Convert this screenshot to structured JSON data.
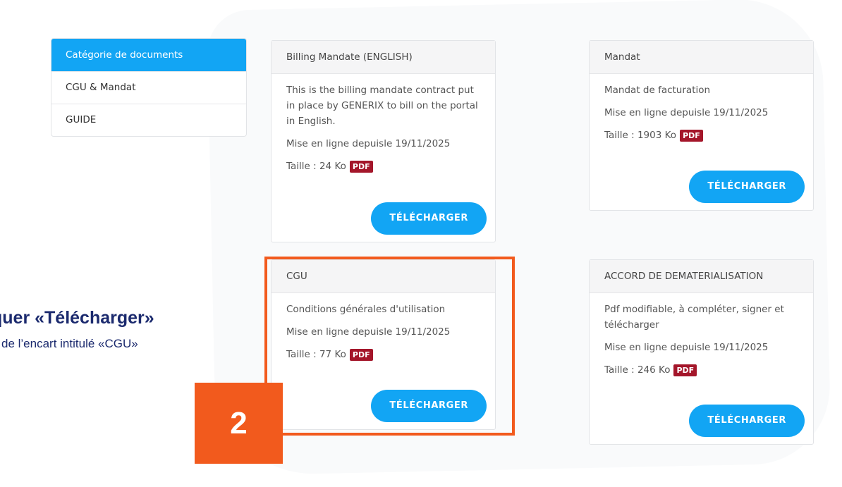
{
  "sidebar": {
    "items": [
      {
        "label": "Catégorie de documents",
        "active": true
      },
      {
        "label": "CGU & Mandat"
      },
      {
        "label": "GUIDE"
      }
    ]
  },
  "cards": [
    {
      "title": "Billing Mandate (ENGLISH)",
      "description": "This is the billing mandate contract put in place by GENERIX to bill on the portal in English.",
      "date": "Mise en ligne depuisle 19/11/2025",
      "size": "Taille : 24 Ko",
      "format": "PDF",
      "button": "TÉLÉCHARGER"
    },
    {
      "title": "Mandat",
      "description": "Mandat de facturation",
      "date": "Mise en ligne depuisle 19/11/2025",
      "size": "Taille : 1903 Ko",
      "format": "PDF",
      "button": "TÉLÉCHARGER"
    },
    {
      "title": "CGU",
      "description": "Conditions générales d'utilisation",
      "date": "Mise en ligne depuisle 19/11/2025",
      "size": "Taille : 77 Ko",
      "format": "PDF",
      "button": "TÉLÉCHARGER"
    },
    {
      "title": "ACCORD DE DEMATERIALISATION",
      "description": "Pdf modifiable, à compléter, signer et télécharger",
      "date": "Mise en ligne depuisle 19/11/2025",
      "size": "Taille : 246 Ko",
      "format": "PDF",
      "button": "TÉLÉCHARGER"
    }
  ],
  "annotation": {
    "step": "2",
    "title": "quer «Télécharger»",
    "subtitle": "de l’encart intitulé «CGU»",
    "highlight_color": "#f25a1d"
  },
  "colors": {
    "accent": "#12a5f4",
    "pdf_badge": "#a4162a",
    "annotation_text": "#1b2a6e"
  }
}
